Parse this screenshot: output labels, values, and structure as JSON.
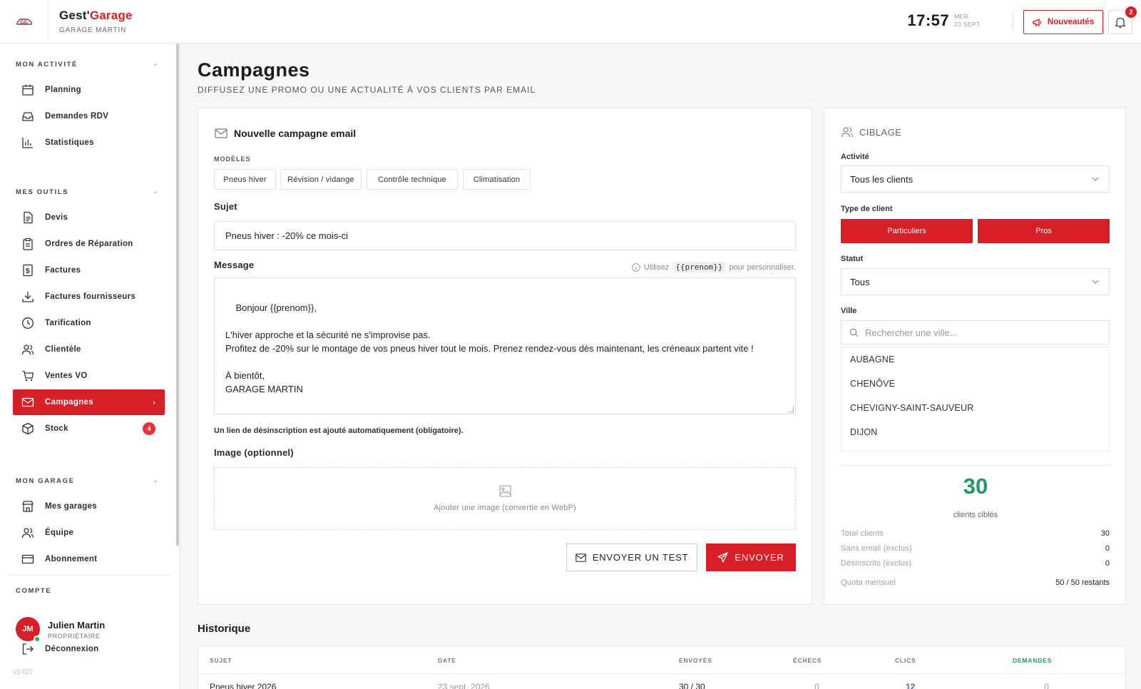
{
  "header": {
    "brand_prefix": "Gest'",
    "brand_suffix": "Garage",
    "garage_name": "GARAGE MARTIN",
    "time": "17:57",
    "day": "MER.",
    "date": "23 SEPT.",
    "news_button": "Nouveautés",
    "notification_count": "2"
  },
  "sidebar": {
    "sections": {
      "activite": "MON ACTIVITÉ",
      "outils": "MES OUTILS",
      "garage": "MON GARAGE",
      "compte": "COMPTE"
    },
    "activite_items": [
      {
        "label": "Planning",
        "icon": "calendar-icon"
      },
      {
        "label": "Demandes RDV",
        "icon": "inbox-icon"
      },
      {
        "label": "Statistiques",
        "icon": "bar-chart-icon"
      }
    ],
    "outils_items": [
      {
        "label": "Devis",
        "icon": "document-icon"
      },
      {
        "label": "Ordres de Réparation",
        "icon": "clipboard-icon"
      },
      {
        "label": "Factures",
        "icon": "invoice-icon"
      },
      {
        "label": "Factures fournisseurs",
        "icon": "download-icon"
      },
      {
        "label": "Tarification",
        "icon": "clock-icon"
      },
      {
        "label": "Clientèle",
        "icon": "users-icon"
      },
      {
        "label": "Ventes VO",
        "icon": "cart-icon"
      },
      {
        "label": "Campagnes",
        "icon": "mail-icon",
        "active": true
      },
      {
        "label": "Stock",
        "icon": "box-icon",
        "badge": "4"
      }
    ],
    "garage_items": [
      {
        "label": "Mes garages",
        "icon": "store-icon"
      },
      {
        "label": "Équipe",
        "icon": "team-icon"
      },
      {
        "label": "Abonnement",
        "icon": "card-icon"
      }
    ],
    "user": {
      "initials": "JM",
      "name": "Julien Martin",
      "role": "PROPRIÉTAIRE"
    },
    "logout": "Déconnexion",
    "version": "v2-027"
  },
  "page": {
    "title": "Campagnes",
    "subtitle": "DIFFUSEZ UNE PROMO OU UNE ACTUALITÉ À VOS CLIENTS PAR EMAIL"
  },
  "campaign": {
    "title": "Nouvelle campagne email",
    "models_label": "MODÈLES",
    "models": [
      "Pneus hiver",
      "Révision / vidange",
      "Contrôle technique",
      "Climatisation"
    ],
    "subject_label": "Sujet",
    "subject_value": "Pneus hiver : -20% ce mois-ci",
    "message_label": "Message",
    "hint_prefix": "Utilisez",
    "hint_code": "{{prenom}}",
    "hint_suffix": "pour personnaliser.",
    "message_value": "Bonjour {{prenom}},\n\nL'hiver approche et la sécurité ne s'improvise pas.\nProfitez de -20% sur le montage de vos pneus hiver tout le mois. Prenez rendez-vous dès maintenant, les créneaux partent vite !\n\nÀ bientôt,\nGARAGE MARTIN",
    "unsubscribe_note": "Un lien de désinscription est ajouté automatiquement (obligatoire).",
    "image_label": "Image (optionnel)",
    "image_drop_text": "Ajouter une image (convertie en WebP)",
    "test_button": "ENVOYER UN TEST",
    "send_button": "ENVOYER"
  },
  "targeting": {
    "title": "CIBLAGE",
    "activity_label": "Activité",
    "activity_value": "Tous les clients",
    "client_type_label": "Type de client",
    "client_types": [
      "Particuliers",
      "Pros"
    ],
    "status_label": "Statut",
    "status_value": "Tous",
    "city_label": "Ville",
    "city_placeholder": "Rechercher une ville...",
    "cities": [
      "AUBAGNE",
      "CHENÔVE",
      "CHEVIGNY-SAINT-SAUVEUR",
      "DIJON"
    ],
    "count": "30",
    "count_label": "clients ciblés",
    "stats": [
      {
        "label": "Total clients",
        "value": "30"
      },
      {
        "label": "Sans email (exclus)",
        "value": "0"
      },
      {
        "label": "Désinscrits (exclus)",
        "value": "0"
      }
    ],
    "quota_label": "Quota mensuel",
    "quota_value": "50 / 50 restants"
  },
  "history": {
    "title": "Historique",
    "columns": [
      "SUJET",
      "DATE",
      "ENVOYÉS",
      "ÉCHECS",
      "CLICS",
      "DEMANDES"
    ],
    "row": {
      "subject": "Pneus hiver 2026",
      "date": "23 sept. 2026",
      "sent": "30 / 30",
      "failed": "0",
      "clicks": "12",
      "requests": "0"
    }
  },
  "colors": {
    "accent": "#d61f26",
    "success": "#1e9a5e",
    "link": "#2b6fd6"
  }
}
